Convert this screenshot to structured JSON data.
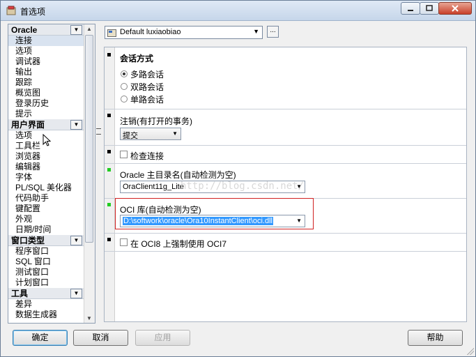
{
  "window": {
    "title": "首选项"
  },
  "sidebar": {
    "categories": [
      {
        "label": "Oracle",
        "items": [
          "连接",
          "选项",
          "调试器",
          "输出",
          "跟踪",
          "概览图",
          "登录历史",
          "提示"
        ]
      },
      {
        "label": "用户界面",
        "items": [
          "选项",
          "工具栏",
          "浏览器",
          "编辑器",
          "字体",
          "PL/SQL 美化器",
          "代码助手",
          "键配置",
          "外观",
          "日期/时间"
        ]
      },
      {
        "label": "窗口类型",
        "items": [
          "程序窗口",
          "SQL 窗口",
          "测试窗口",
          "计划窗口"
        ]
      },
      {
        "label": "工具",
        "items": [
          "差异",
          "数据生成器"
        ]
      }
    ],
    "selected": "连接"
  },
  "profile": {
    "value": "Default luxiaobiao",
    "more_label": "..."
  },
  "sections": {
    "session_mode": {
      "title": "会话方式",
      "options": [
        "多路会话",
        "双路会话",
        "单路会话"
      ],
      "selected": "多路会话"
    },
    "logoff": {
      "title": "注销(有打开的事务)",
      "value": "提交"
    },
    "check_connection": {
      "label": "检查连接",
      "checked": false
    },
    "oracle_home": {
      "title": "Oracle 主目录名(自动检测为空)",
      "value": "OraClient11g_Lite"
    },
    "oci_library": {
      "title": "OCI 库(自动检测为空)",
      "value": "D:\\softwork\\oracle\\Ora10InstantClient\\oci.dll"
    },
    "force_oci7": {
      "label": "在 OCI8 上强制使用 OCI7",
      "checked": false
    }
  },
  "watermark": "http://blog.csdn.net/",
  "buttons": {
    "ok": "确定",
    "cancel": "取消",
    "apply": "应用",
    "help": "帮助"
  },
  "colors": {
    "marker_changed": "#22cc22",
    "marker_default": "#000000",
    "highlight_border": "#d02020",
    "selection": "#3399ff"
  }
}
